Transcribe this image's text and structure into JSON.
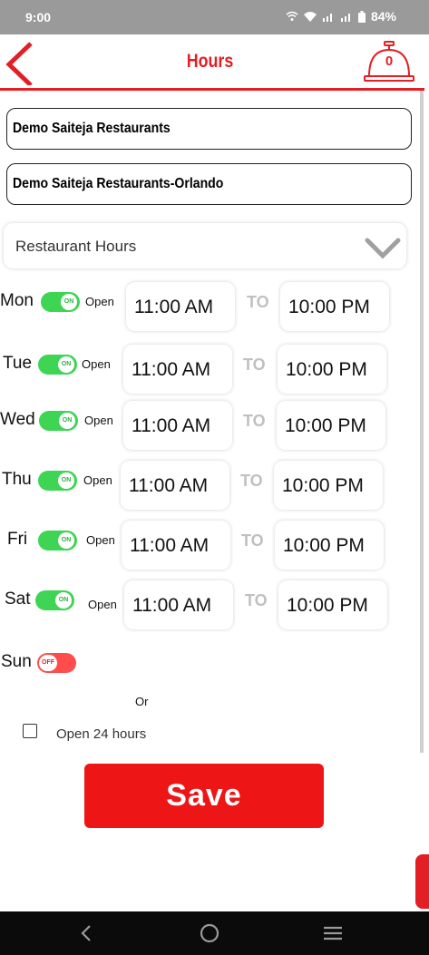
{
  "status_bar": {
    "time": "9:00",
    "battery": "84%"
  },
  "header": {
    "title": "Hours",
    "cart_count": "0",
    "accent": "#e31e24"
  },
  "stores": [
    "Demo Saiteja Restaurants",
    "Demo Saiteja Restaurants-Orlando"
  ],
  "dropdown": {
    "selected": "Restaurant Hours"
  },
  "days": [
    {
      "day": "Mon",
      "toggle": "ON",
      "status": "Open",
      "open": "11:00 AM",
      "to": "TO",
      "close": "10:00 PM"
    },
    {
      "day": "Tue",
      "toggle": "ON",
      "status": "Open",
      "open": "11:00 AM",
      "to": "TO",
      "close": "10:00 PM"
    },
    {
      "day": "Wed",
      "toggle": "ON",
      "status": "Open",
      "open": "11:00 AM",
      "to": "TO",
      "close": "10:00 PM"
    },
    {
      "day": "Thu",
      "toggle": "ON",
      "status": "Open",
      "open": "11:00 AM",
      "to": "TO",
      "close": "10:00 PM"
    },
    {
      "day": "Fri",
      "toggle": "ON",
      "status": "Open",
      "open": "11:00 AM",
      "to": "TO",
      "close": "10:00 PM"
    },
    {
      "day": "Sat",
      "toggle": "ON",
      "status": "Open",
      "open": "11:00 AM",
      "to": "TO",
      "close": "10:00 PM"
    }
  ],
  "sunday": {
    "day": "Sun",
    "toggle": "OFF"
  },
  "or_label": "Or",
  "open_24": {
    "label": "Open 24 hours",
    "checked": false
  },
  "save_label": "Save",
  "colors": {
    "toggle_on": "#3dd553",
    "toggle_off": "#ff4d4d",
    "save": "#ed1515"
  }
}
